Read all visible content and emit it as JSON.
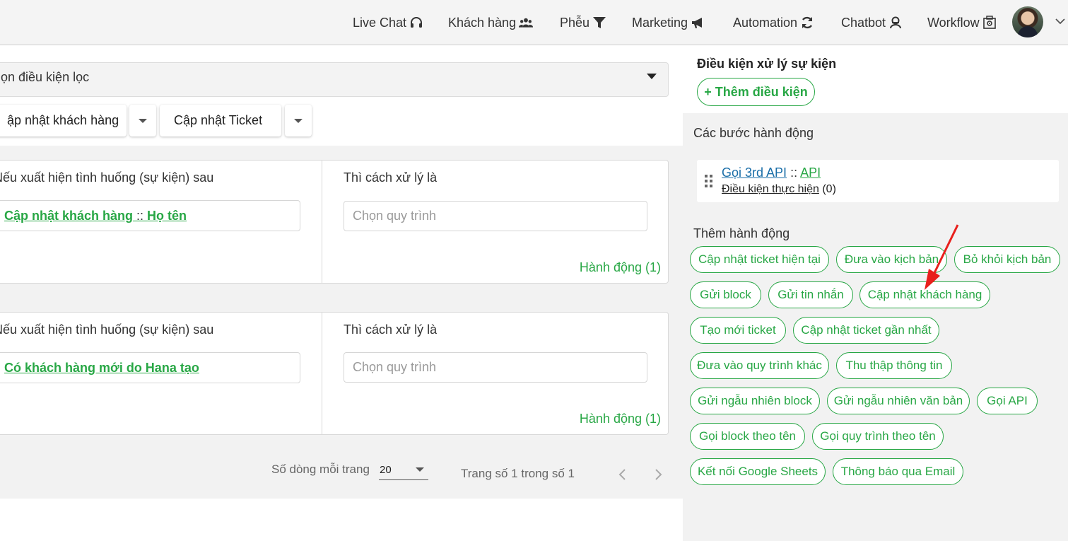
{
  "nav": {
    "items": [
      {
        "label": "Live Chat",
        "icon": "headset-icon"
      },
      {
        "label": "Khách hàng",
        "icon": "users-icon"
      },
      {
        "label": "Phễu",
        "icon": "filter-icon"
      },
      {
        "label": "Marketing",
        "icon": "megaphone-icon"
      },
      {
        "label": "Automation",
        "icon": "sync-icon"
      },
      {
        "label": "Chatbot",
        "icon": "bot-icon"
      },
      {
        "label": "Workflow",
        "icon": "workflow-icon"
      }
    ]
  },
  "left": {
    "filter_placeholder": "ọn điều kiện lọc",
    "btn_update_customer": "ập nhật khách hàng",
    "btn_update_ticket": "Cập nhật Ticket",
    "rules": [
      {
        "if_label": "Nếu xuất hiện tình huống (sự kiện) sau",
        "then_label": "Thì cách xử lý là",
        "event_main": "Cập nhật khách hàng",
        "event_sep": " :: ",
        "event_sub": "Họ tên",
        "process_placeholder": "Chọn quy trình",
        "action_link": "Hành động (1)"
      },
      {
        "if_label": "Nếu xuất hiện tình huống (sự kiện) sau",
        "then_label": "Thì cách xử lý là",
        "event_main": "Có khách hàng mới do Hana tạo",
        "process_placeholder": "Chọn quy trình",
        "action_link": "Hành động (1)"
      }
    ],
    "pager": {
      "rows_label": "Số dòng mỗi trang",
      "rows_value": "20",
      "page_info": "Trang số 1 trong số 1"
    }
  },
  "right": {
    "event_condition_title": "Điều kiện xử lý sự kiện",
    "add_condition": "+ Thêm điều kiện",
    "steps_title": "Các bước hành động",
    "step": {
      "name": "Gọi 3rd API",
      "sep": " :: ",
      "type": "API",
      "condition_label": "Điều kiện thực hiện",
      "condition_count": " (0)"
    },
    "add_action_title": "Thêm hành động",
    "chips": [
      "Cập nhật ticket hiện tại",
      "Đưa vào kịch bản",
      "Bỏ khỏi kịch bản",
      "Gửi block",
      "Gửi tin nhắn",
      "Cập nhật khách hàng",
      "Tạo mới ticket",
      "Cập nhật ticket gần nhất",
      "Đưa vào quy trình khác",
      "Thu thập thông tin",
      "Gửi ngẫu nhiên block",
      "Gửi ngẫu nhiên văn bản",
      "Gọi API",
      "Gọi block theo tên",
      "Gọi quy trình theo tên",
      "Kết nối Google Sheets",
      "Thông báo qua Email"
    ]
  },
  "colors": {
    "accent": "#28a745",
    "link_blue": "#1a6ea8",
    "arrow": "#e8201c"
  }
}
